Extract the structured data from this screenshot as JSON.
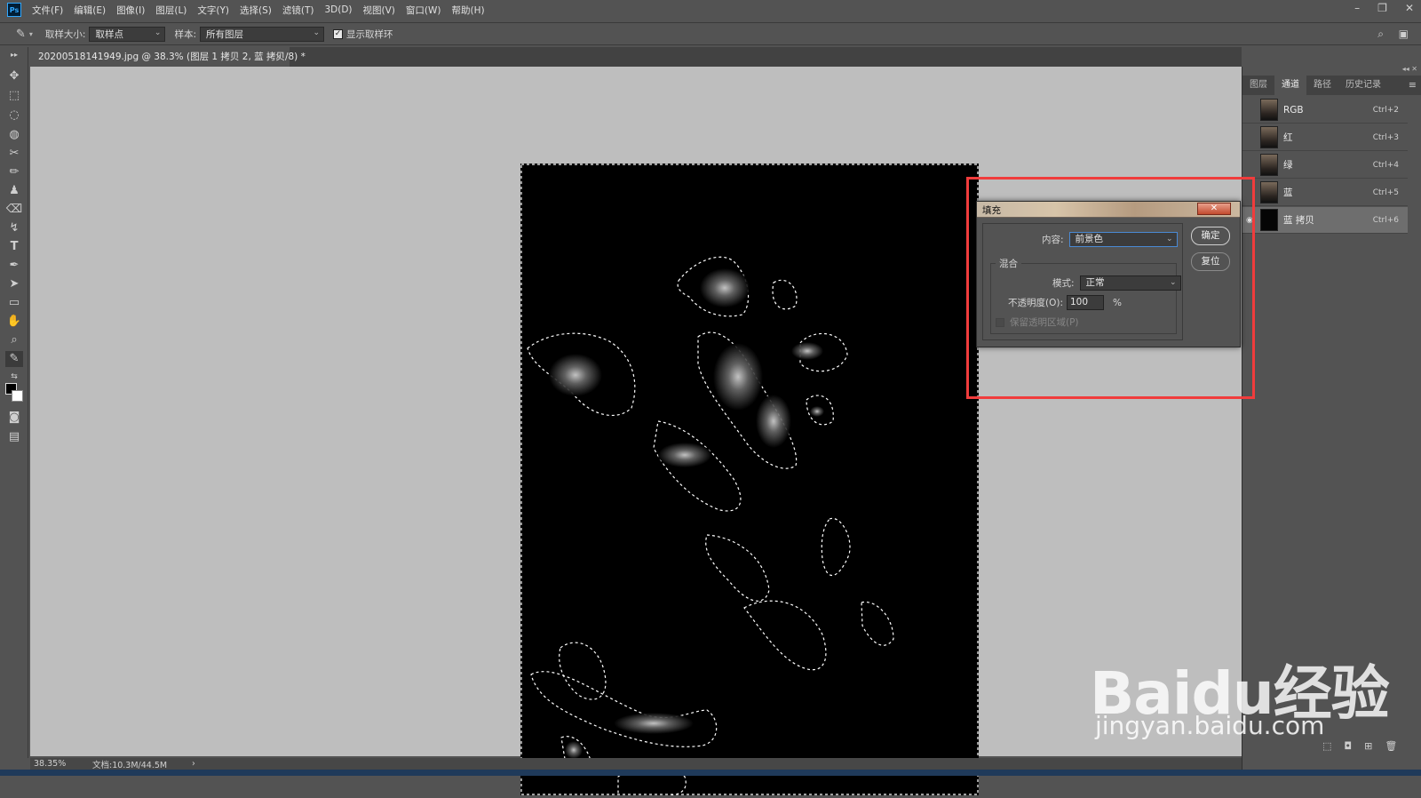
{
  "app": {
    "logo": "Ps"
  },
  "menu": [
    "文件(F)",
    "编辑(E)",
    "图像(I)",
    "图层(L)",
    "文字(Y)",
    "选择(S)",
    "滤镜(T)",
    "3D(D)",
    "视图(V)",
    "窗口(W)",
    "帮助(H)"
  ],
  "window_controls": {
    "minimize": "–",
    "restore": "❐",
    "close": "✕"
  },
  "options": {
    "sample_size_label": "取样大小:",
    "sample_size_value": "取样点",
    "sample_label": "样本:",
    "sample_value": "所有图层",
    "show_ring_label": "显示取样环",
    "show_ring_checked": true
  },
  "document": {
    "tab_title": "20200518141949.jpg @ 38.3% (图层 1 拷贝 2, 蓝 拷贝/8) *",
    "tab_close": "×"
  },
  "status": {
    "zoom": "38.35%",
    "doc_size": "文档:10.3M/44.5M",
    "arrow": "›"
  },
  "panel": {
    "tabs": [
      "图层",
      "通道",
      "路径",
      "历史记录"
    ],
    "active_tab": 1,
    "menu_icon": "≡",
    "channels": [
      {
        "name": "RGB",
        "shortcut": "Ctrl+2"
      },
      {
        "name": "红",
        "shortcut": "Ctrl+3"
      },
      {
        "name": "绿",
        "shortcut": "Ctrl+4"
      },
      {
        "name": "蓝",
        "shortcut": "Ctrl+5"
      },
      {
        "name": "蓝 拷贝",
        "shortcut": "Ctrl+6"
      }
    ],
    "selected_channel": 4
  },
  "fill_dialog": {
    "title": "填充",
    "close": "✕",
    "content_label": "内容:",
    "content_value": "前景色",
    "blend_group_label": "混合",
    "mode_label": "模式:",
    "mode_value": "正常",
    "opacity_label": "不透明度(O):",
    "opacity_value": "100",
    "opacity_unit": "%",
    "preserve_label": "保留透明区域(P)",
    "ok_label": "确定",
    "reset_label": "复位"
  },
  "watermark": {
    "main": "Baidu经验",
    "sub": "jingyan.baidu.com"
  },
  "colors": {
    "highlight": "#f03c3c",
    "ui_bg": "#535353",
    "canvas_bg": "#bebebe"
  }
}
